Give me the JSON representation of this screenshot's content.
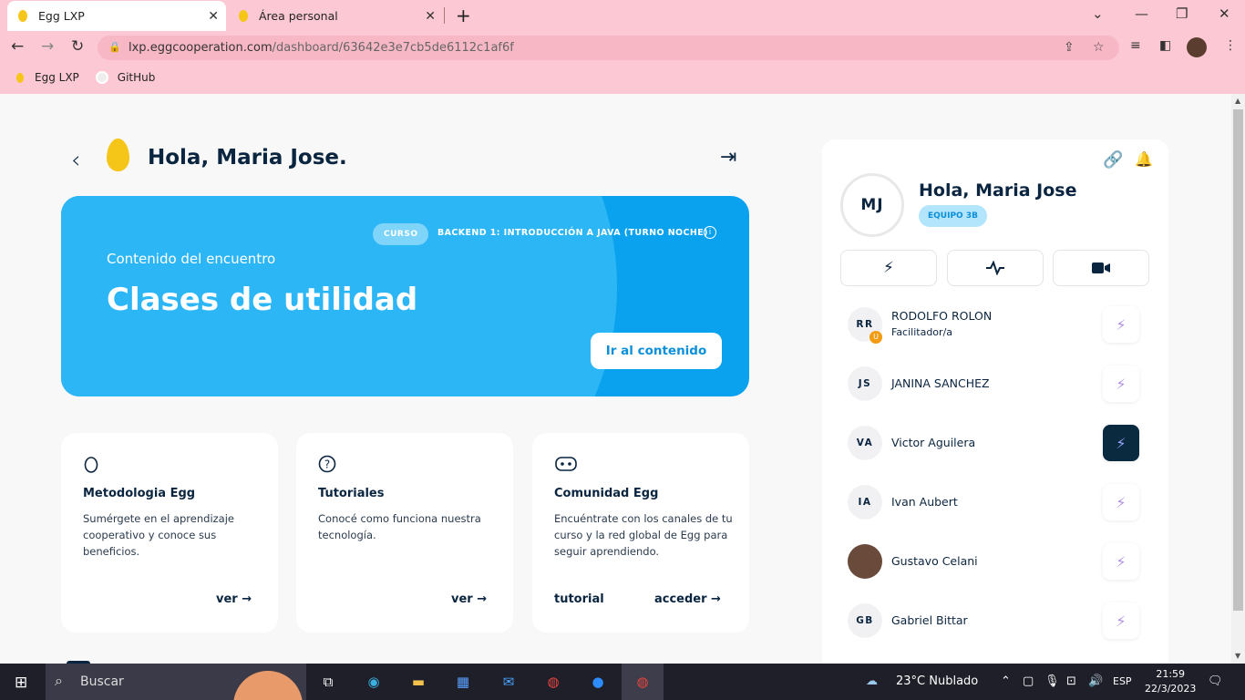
{
  "browser": {
    "tabs": [
      {
        "title": "Egg LXP",
        "close": "✕"
      },
      {
        "title": "Área personal",
        "close": "✕"
      }
    ],
    "new_tab": "+",
    "window_controls": {
      "minimize": "—",
      "maximize": "❐",
      "close": "✕",
      "tab_search": "⌄"
    },
    "nav": {
      "back": "←",
      "forward": "→",
      "reload": "↻"
    },
    "url_host": "lxp.eggcooperation.com",
    "url_path": "/dashboard/63642e3e7cb5de6112c1af6f",
    "bookmarks": [
      {
        "label": "Egg LXP"
      },
      {
        "label": "GitHub"
      }
    ]
  },
  "header": {
    "back_icon": "‹",
    "greeting": "Hola, Maria Jose.",
    "logout_icon": "⇥"
  },
  "hero": {
    "badge": "CURSO",
    "course_name": "BACKEND 1: INTRODUCCIÓN A JAVA (TURNO NOCHE)",
    "info_icon": "i",
    "subtitle": "Contenido del encuentro",
    "title": "Clases de utilidad",
    "button": "Ir al contenido"
  },
  "cards": [
    {
      "icon": "egg-outline-icon",
      "title": "Metodologia Egg",
      "description": "Sumérgete en el aprendizaje cooperativo y conoce sus beneficios.",
      "links": [
        "ver →"
      ]
    },
    {
      "icon": "question-circle-icon",
      "title": "Tutoriales",
      "description": "Conocé como funciona nuestra tecnología.",
      "links": [
        "ver →"
      ]
    },
    {
      "icon": "discord-icon",
      "title": "Comunidad Egg",
      "description": "Encuéntrate con los canales de tu curso y la red global de Egg para seguir aprendiendo.",
      "links": [
        "tutorial",
        "acceder →"
      ]
    }
  ],
  "sidebar": {
    "initials": "MJ",
    "greeting": "Hola, Maria Jose",
    "team": "EQUIPO 3B",
    "segments": [
      "lightning-icon",
      "activity-icon",
      "video-icon"
    ],
    "members": [
      {
        "initials": "RR",
        "name": "RODOLFO ROLON",
        "role": "Facilitador/a",
        "badge": "U"
      },
      {
        "initials": "JS",
        "name": "JANINA SANCHEZ"
      },
      {
        "initials": "VA",
        "name": "Victor Aguilera",
        "active": true
      },
      {
        "initials": "IA",
        "name": "Ivan Aubert"
      },
      {
        "initials": "",
        "name": "Gustavo Celani",
        "photo": true
      },
      {
        "initials": "GB",
        "name": "Gabriel Bittar"
      }
    ]
  },
  "taskbar": {
    "search_placeholder": "Buscar",
    "weather": "23°C  Nublado",
    "language": "ESP",
    "time": "21:59",
    "date": "22/3/2023"
  },
  "colors": {
    "chrome_bg": "#fcc8d4",
    "hero_blue": "#0aa2ee",
    "navy": "#0a2540",
    "egg_yellow": "#f5c518"
  }
}
